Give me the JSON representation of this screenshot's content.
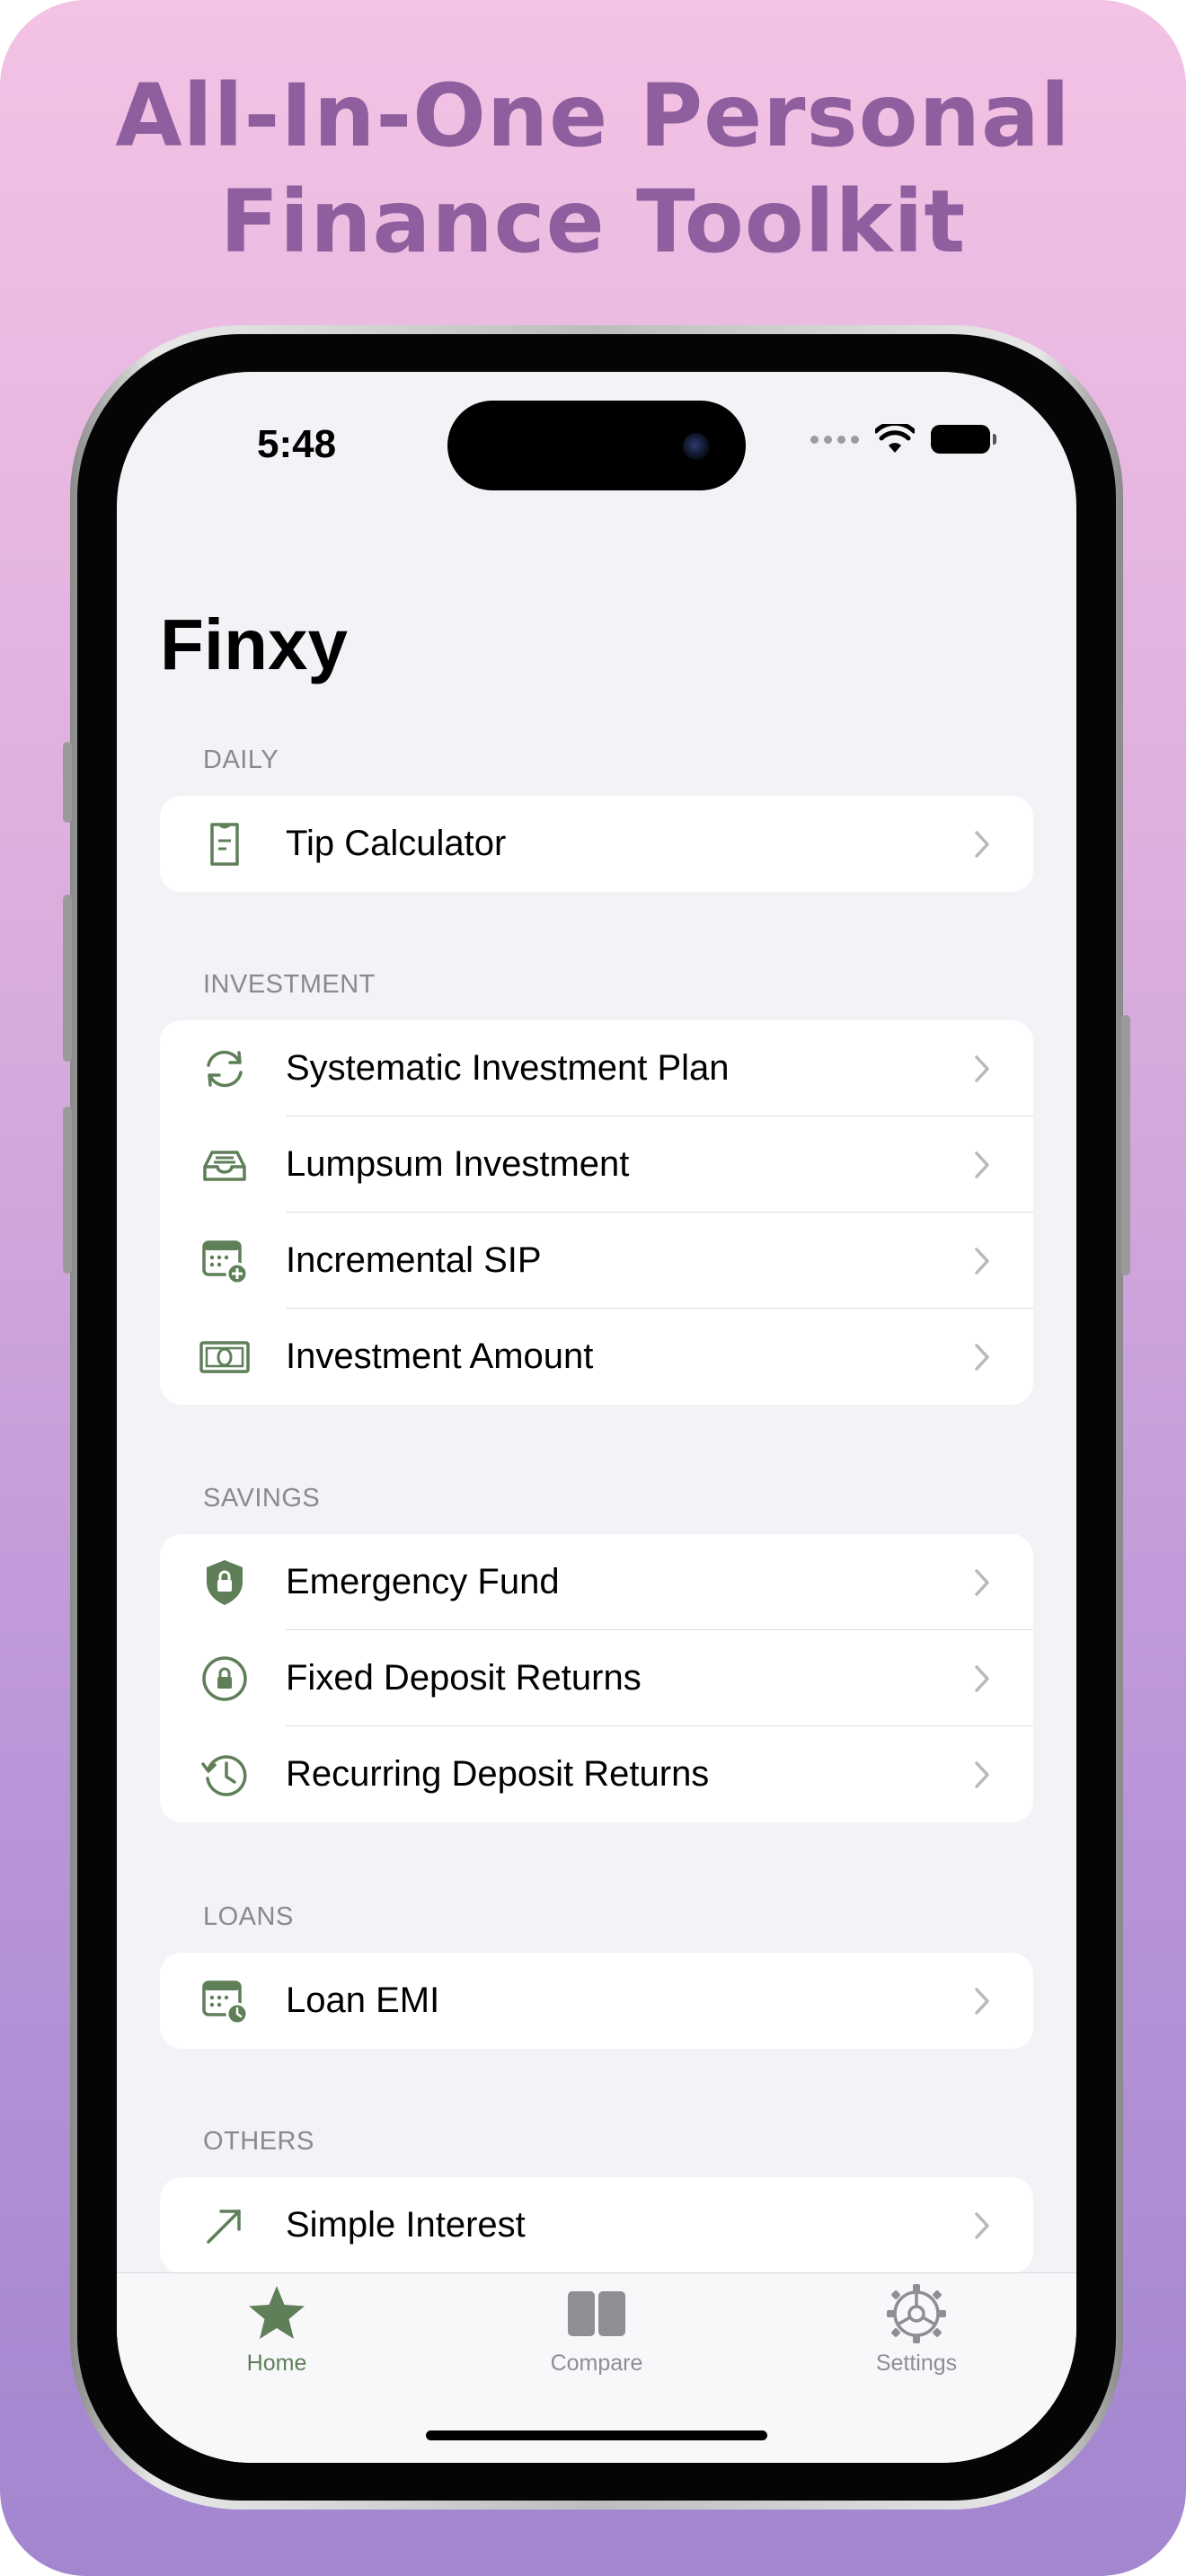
{
  "headline": {
    "line1": "All-In-One Personal",
    "line2": "Finance Toolkit"
  },
  "status_bar": {
    "time": "5:48"
  },
  "app": {
    "title": "Finxy"
  },
  "sections": [
    {
      "header": "DAILY",
      "items": [
        {
          "label": "Tip Calculator",
          "icon": "receipt-icon"
        }
      ]
    },
    {
      "header": "INVESTMENT",
      "items": [
        {
          "label": "Systematic Investment Plan",
          "icon": "refresh-icon"
        },
        {
          "label": "Lumpsum Investment",
          "icon": "tray-icon"
        },
        {
          "label": "Incremental SIP",
          "icon": "calendar-plus-icon"
        },
        {
          "label": "Investment Amount",
          "icon": "banknote-icon"
        }
      ]
    },
    {
      "header": "SAVINGS",
      "items": [
        {
          "label": "Emergency Fund",
          "icon": "shield-lock-icon"
        },
        {
          "label": "Fixed Deposit Returns",
          "icon": "lock-circle-icon"
        },
        {
          "label": "Recurring Deposit Returns",
          "icon": "history-clock-icon"
        }
      ]
    },
    {
      "header": "LOANS",
      "items": [
        {
          "label": "Loan EMI",
          "icon": "calendar-clock-icon"
        }
      ]
    },
    {
      "header": "OTHERS",
      "items": [
        {
          "label": "Simple Interest",
          "icon": "arrow-up-right-icon"
        }
      ]
    }
  ],
  "tabbar": {
    "tabs": [
      {
        "label": "Home",
        "icon": "star-icon",
        "active": true
      },
      {
        "label": "Compare",
        "icon": "compare-icon",
        "active": false
      },
      {
        "label": "Settings",
        "icon": "gear-icon",
        "active": false
      }
    ]
  },
  "colors": {
    "accent": "#5e7f58",
    "headline": "#8e5e9e",
    "inactive_tab": "#8e8e93",
    "secondary_text": "#8a8a8e"
  }
}
